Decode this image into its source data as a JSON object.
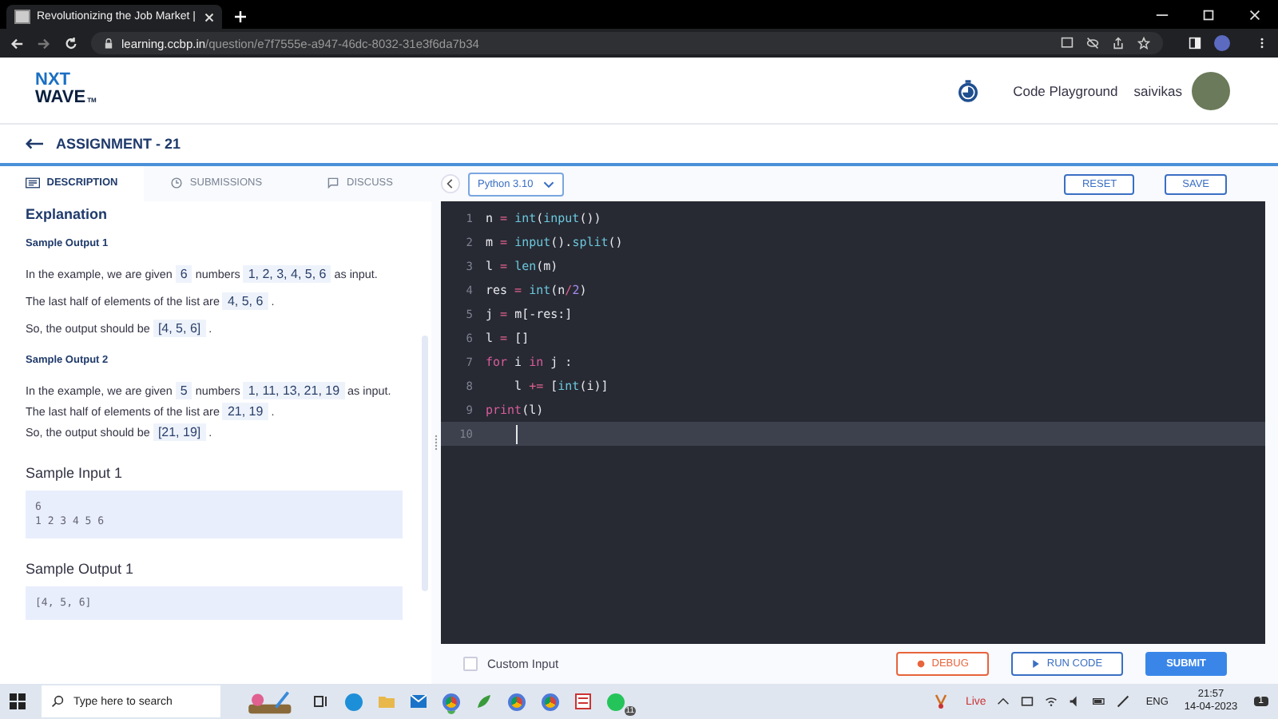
{
  "browser": {
    "tab_title": "Revolutionizing the Job Market |",
    "url_host": "learning.ccbp.in",
    "url_path": "/question/e7f7555e-a947-46dc-8032-31e3f6da7b34"
  },
  "header": {
    "logo_top": "NXT",
    "logo_bottom": "WAVE",
    "logo_mark": "TM",
    "playground": "Code Playground",
    "user": "saivikas"
  },
  "assignment": {
    "title": "ASSIGNMENT - 21"
  },
  "tabs": [
    {
      "label": "DESCRIPTION",
      "selected": true
    },
    {
      "label": "SUBMISSIONS",
      "selected": false
    },
    {
      "label": "DISCUSS",
      "selected": false
    }
  ],
  "language": "Python 3.10",
  "editor_buttons": [
    "RESET",
    "SAVE"
  ],
  "description": {
    "heading": "Explanation",
    "blocks": [
      {
        "kind": "subheading",
        "text": "Sample Output 1"
      },
      {
        "kind": "para",
        "segments": [
          {
            "text": "In the example, we are given ",
            "code": false
          },
          {
            "text": "6",
            "code": true
          },
          {
            "text": " numbers ",
            "code": false
          },
          {
            "text": "1, 2, 3, 4, 5, 6",
            "code": true
          },
          {
            "text": " as input.",
            "code": false
          }
        ]
      },
      {
        "kind": "para",
        "segments": [
          {
            "text": "The last half of elements of the list are ",
            "code": false
          },
          {
            "text": "4, 5, 6",
            "code": true
          },
          {
            "text": " .",
            "code": false
          }
        ]
      },
      {
        "kind": "line",
        "segments": [
          {
            "text": "So, the output should be ",
            "code": false
          },
          {
            "text": "[4, 5, 6]",
            "code": true
          },
          {
            "text": " .",
            "code": false
          }
        ]
      },
      {
        "kind": "subheading",
        "text": "Sample Output 2"
      },
      {
        "kind": "line",
        "segments": [
          {
            "text": "In the example, we are given ",
            "code": false
          },
          {
            "text": "5",
            "code": true
          },
          {
            "text": " numbers ",
            "code": false
          },
          {
            "text": "1, 11, 13, 21, 19",
            "code": true
          },
          {
            "text": " as input.",
            "code": false
          }
        ]
      },
      {
        "kind": "line",
        "segments": [
          {
            "text": "The last half of elements of the list are ",
            "code": false
          },
          {
            "text": "21, 19",
            "code": true
          },
          {
            "text": " .",
            "code": false
          }
        ]
      },
      {
        "kind": "line",
        "segments": [
          {
            "text": "So, the output should be ",
            "code": false
          },
          {
            "text": "[21, 19]",
            "code": true
          },
          {
            "text": " .",
            "code": false
          }
        ]
      },
      {
        "kind": "title",
        "text": "Sample Input 1"
      },
      {
        "kind": "sample",
        "lines": [
          "6",
          "1 2 3 4 5 6"
        ]
      },
      {
        "kind": "title",
        "text": "Sample Output 1"
      },
      {
        "kind": "sample",
        "lines": [
          "[4, 5, 6]"
        ]
      }
    ]
  },
  "code": [
    {
      "number": "1",
      "active": false,
      "tokens": [
        {
          "text": "n",
          "kind": "var"
        },
        {
          "text": " = ",
          "kind": "op"
        },
        {
          "text": "int",
          "kind": "fn"
        },
        {
          "text": "(",
          "kind": "punct"
        },
        {
          "text": "input",
          "kind": "fn"
        },
        {
          "text": "())",
          "kind": "punct"
        }
      ]
    },
    {
      "number": "2",
      "active": false,
      "tokens": [
        {
          "text": "m",
          "kind": "var"
        },
        {
          "text": " = ",
          "kind": "op"
        },
        {
          "text": "input",
          "kind": "fn"
        },
        {
          "text": "().",
          "kind": "punct"
        },
        {
          "text": "split",
          "kind": "fn"
        },
        {
          "text": "()",
          "kind": "punct"
        }
      ]
    },
    {
      "number": "3",
      "active": false,
      "tokens": [
        {
          "text": "l",
          "kind": "var"
        },
        {
          "text": " = ",
          "kind": "op"
        },
        {
          "text": "len",
          "kind": "fn"
        },
        {
          "text": "(m)",
          "kind": "punct"
        }
      ]
    },
    {
      "number": "4",
      "active": false,
      "tokens": [
        {
          "text": "res",
          "kind": "var"
        },
        {
          "text": " = ",
          "kind": "op"
        },
        {
          "text": "int",
          "kind": "fn"
        },
        {
          "text": "(n",
          "kind": "punct"
        },
        {
          "text": "/",
          "kind": "op"
        },
        {
          "text": "2",
          "kind": "num"
        },
        {
          "text": ")",
          "kind": "punct"
        }
      ]
    },
    {
      "number": "5",
      "active": false,
      "tokens": [
        {
          "text": "j",
          "kind": "var"
        },
        {
          "text": " = ",
          "kind": "op"
        },
        {
          "text": "m[-res:]",
          "kind": "punct"
        }
      ]
    },
    {
      "number": "6",
      "active": false,
      "tokens": [
        {
          "text": "l",
          "kind": "var"
        },
        {
          "text": " = ",
          "kind": "op"
        },
        {
          "text": "[]",
          "kind": "punct"
        }
      ]
    },
    {
      "number": "7",
      "active": false,
      "tokens": [
        {
          "text": "for",
          "kind": "kw"
        },
        {
          "text": " i ",
          "kind": "var"
        },
        {
          "text": "in",
          "kind": "kw"
        },
        {
          "text": " j :",
          "kind": "var"
        }
      ]
    },
    {
      "number": "8",
      "active": false,
      "tokens": [
        {
          "text": "    l",
          "kind": "var"
        },
        {
          "text": " += ",
          "kind": "op"
        },
        {
          "text": "[",
          "kind": "punct"
        },
        {
          "text": "int",
          "kind": "fn"
        },
        {
          "text": "(i)]",
          "kind": "punct"
        }
      ]
    },
    {
      "number": "9",
      "active": false,
      "tokens": [
        {
          "text": "print",
          "kind": "kw"
        },
        {
          "text": "(l)",
          "kind": "punct"
        }
      ]
    },
    {
      "number": "10",
      "active": true
    }
  ],
  "custom_input": {
    "label": "Custom Input",
    "checked": false
  },
  "actions": [
    {
      "label": "DEBUG",
      "kind": "debug"
    },
    {
      "label": "RUN CODE",
      "kind": "run"
    },
    {
      "label": "SUBMIT",
      "kind": "submit"
    }
  ],
  "taskbar": {
    "search_placeholder": "Type here to search",
    "whatsapp_badge": "11",
    "live": "Live",
    "language": "ENG",
    "time": "21:57",
    "date": "14-04-2023",
    "notification_count": "1"
  }
}
